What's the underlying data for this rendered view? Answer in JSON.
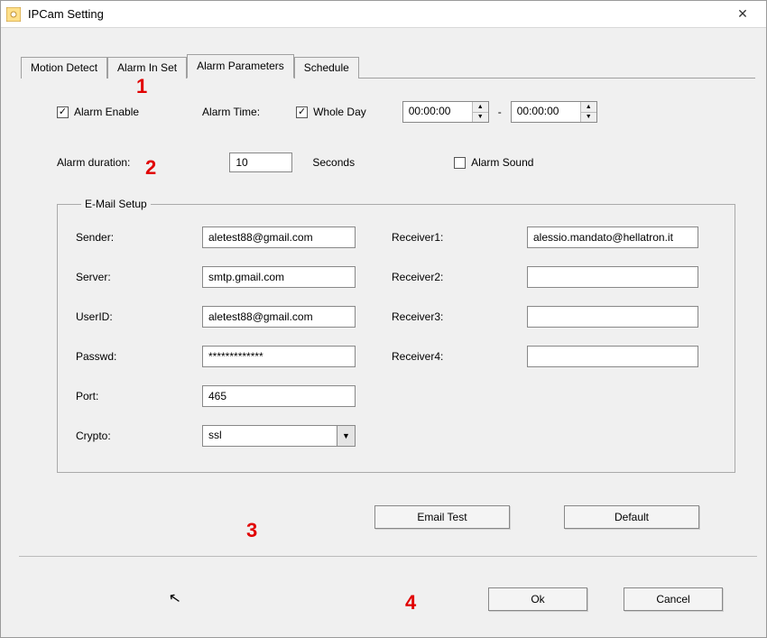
{
  "window": {
    "title": "IPCam Setting"
  },
  "tabs": [
    "Motion Detect",
    "Alarm In Set",
    "Alarm Parameters",
    "Schedule"
  ],
  "active_tab_index": 2,
  "alarm": {
    "enable_label": "Alarm Enable",
    "enable_checked": true,
    "time_label": "Alarm Time:",
    "whole_day_label": "Whole Day",
    "whole_day_checked": true,
    "time_from": "00:00:00",
    "time_sep": "-",
    "time_to": "00:00:00",
    "duration_label": "Alarm duration:",
    "duration_value": "10",
    "duration_unit": "Seconds",
    "sound_label": "Alarm Sound",
    "sound_checked": false
  },
  "email": {
    "legend": "E-Mail Setup",
    "sender_label": "Sender:",
    "sender": "aletest88@gmail.com",
    "server_label": "Server:",
    "server": "smtp.gmail.com",
    "userid_label": "UserID:",
    "userid": "aletest88@gmail.com",
    "passwd_label": "Passwd:",
    "passwd": "*************",
    "port_label": "Port:",
    "port": "465",
    "crypto_label": "Crypto:",
    "crypto": "ssl",
    "receiver1_label": "Receiver1:",
    "receiver1": "alessio.mandato@hellatron.it",
    "receiver2_label": "Receiver2:",
    "receiver2": "",
    "receiver3_label": "Receiver3:",
    "receiver3": "",
    "receiver4_label": "Receiver4:",
    "receiver4": ""
  },
  "buttons": {
    "email_test": "Email Test",
    "default": "Default",
    "ok": "Ok",
    "cancel": "Cancel"
  },
  "annotations": {
    "a1": "1",
    "a2": "2",
    "a3": "3",
    "a4": "4"
  }
}
